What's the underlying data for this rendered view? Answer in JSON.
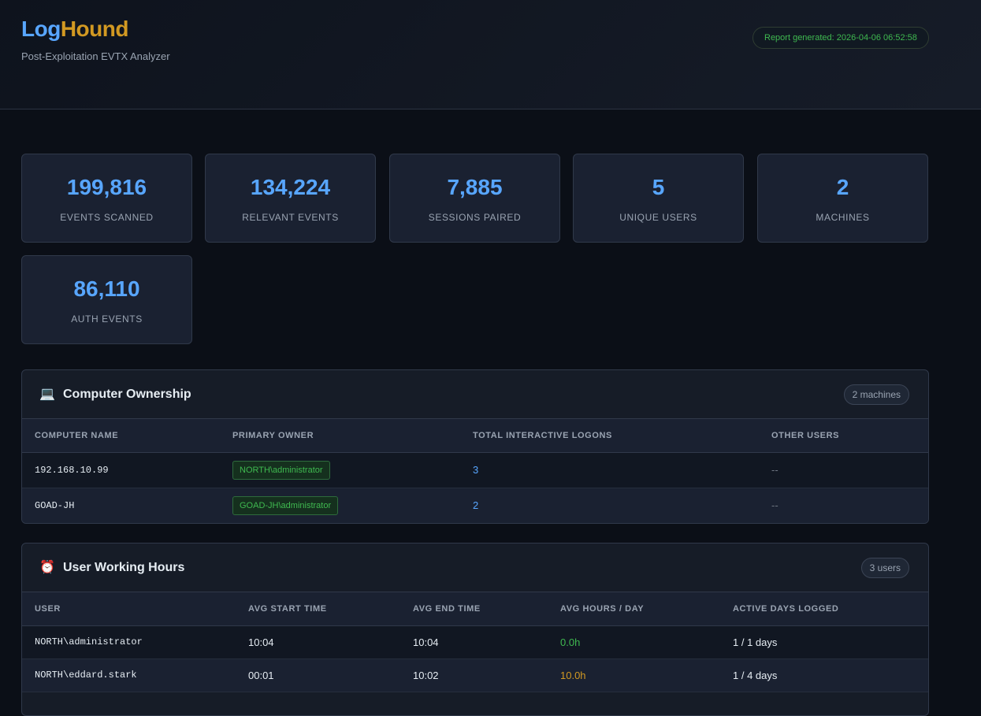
{
  "header": {
    "logo_part1": "Log",
    "logo_part2": "Hound",
    "subtitle": "Post-Exploitation EVTX Analyzer",
    "report_generated": "Report generated: 2026-04-06 06:52:58"
  },
  "stats": [
    {
      "value": "199,816",
      "label": "EVENTS SCANNED"
    },
    {
      "value": "134,224",
      "label": "RELEVANT EVENTS"
    },
    {
      "value": "7,885",
      "label": "SESSIONS PAIRED"
    },
    {
      "value": "5",
      "label": "UNIQUE USERS"
    },
    {
      "value": "2",
      "label": "MACHINES"
    },
    {
      "value": "86,110",
      "label": "AUTH EVENTS"
    }
  ],
  "computer_ownership": {
    "icon": "laptop-icon",
    "title": "Computer Ownership",
    "count": "2 machines",
    "columns": [
      "COMPUTER NAME",
      "PRIMARY OWNER",
      "TOTAL INTERACTIVE LOGONS",
      "OTHER USERS"
    ],
    "rows": [
      {
        "computer": "192.168.10.99",
        "owner": "NORTH\\administrator",
        "logons": "3",
        "other": "--"
      },
      {
        "computer": "GOAD-JH",
        "owner": "GOAD-JH\\administrator",
        "logons": "2",
        "other": "--"
      }
    ]
  },
  "working_hours": {
    "icon": "alarm-clock-icon",
    "title": "User Working Hours",
    "count": "3 users",
    "columns": [
      "USER",
      "AVG START TIME",
      "AVG END TIME",
      "AVG HOURS / DAY",
      "ACTIVE DAYS LOGGED"
    ],
    "rows": [
      {
        "user": "NORTH\\administrator",
        "start": "10:04",
        "end": "10:04",
        "hours": "0.0h",
        "days": "1 / 1 days"
      },
      {
        "user": "NORTH\\eddard.stark",
        "start": "00:01",
        "end": "10:02",
        "hours": "10.0h",
        "days": "1 / 4 days"
      }
    ]
  },
  "colors": {
    "accent": "#58a6ff",
    "brand_secondary": "#d29922",
    "good": "#3fb950",
    "warn": "#d29922"
  }
}
